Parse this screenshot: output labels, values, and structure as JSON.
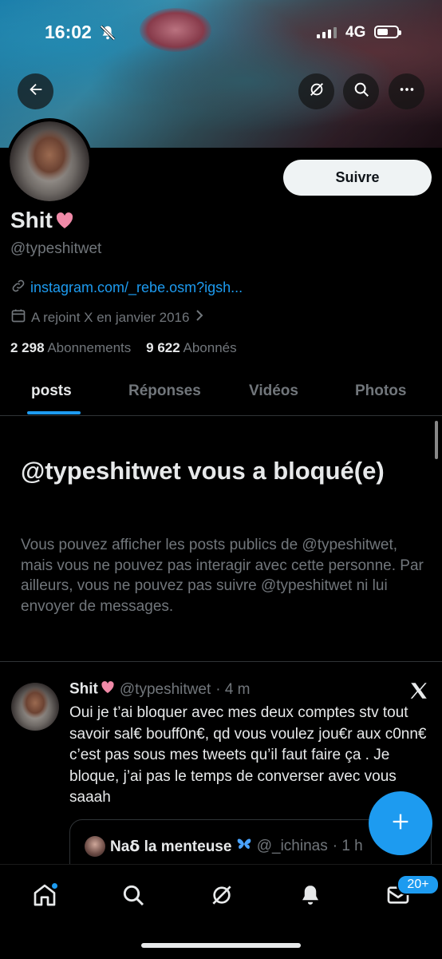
{
  "status_bar": {
    "time": "16:02",
    "network": "4G"
  },
  "header": {
    "back_label": "",
    "follow_label": "Suivre"
  },
  "profile": {
    "display_name": "Shit",
    "handle": "@typeshitwet",
    "link": "instagram.com/_rebe.osm?igsh...",
    "joined": "A rejoint X en janvier 2016",
    "following_count": "2 298",
    "following_label": "Abonnements",
    "followers_count": "9 622",
    "followers_label": "Abonnés"
  },
  "tabs": [
    {
      "label": "posts",
      "active": true
    },
    {
      "label": "Réponses",
      "active": false
    },
    {
      "label": "Vidéos",
      "active": false
    },
    {
      "label": "Photos",
      "active": false
    }
  ],
  "blocked_notice": {
    "title": "@typeshitwet vous a bloqué(e)",
    "body": "Vous pouvez afficher les posts publics de @typeshitwet, mais vous ne pouvez pas interagir avec cette personne. Par ailleurs, vous ne pouvez pas suivre @typeshitwet ni lui envoyer de messages."
  },
  "tweet": {
    "name": "Shit",
    "handle": "@typeshitwet",
    "time": "· 4 m",
    "text": "Oui je t’ai bloquer avec mes deux comptes stv tout savoir sal€ bouff0n€, qd vous voulez jou€r aux c0nn€ c’est pas sous mes tweets qu’il faut faire ça . Je bloque, j’ai pas le temps de converser avec vous saaah",
    "quote": {
      "name": "Naẟ la menteuse",
      "handle": "@_ichinas",
      "time": "· 1 h"
    }
  },
  "bottom_nav": {
    "messages_badge": "20+"
  },
  "colors": {
    "accent": "#1d9bf0",
    "background": "#000000",
    "muted": "#71767b",
    "text": "#e7e9ea"
  },
  "icons": [
    "back-arrow-icon",
    "grok-icon",
    "search-icon",
    "more-icon",
    "link-icon",
    "calendar-icon",
    "chevron-right-icon",
    "x-logo-icon",
    "plus-icon",
    "home-icon",
    "notifications-icon",
    "messages-icon"
  ]
}
